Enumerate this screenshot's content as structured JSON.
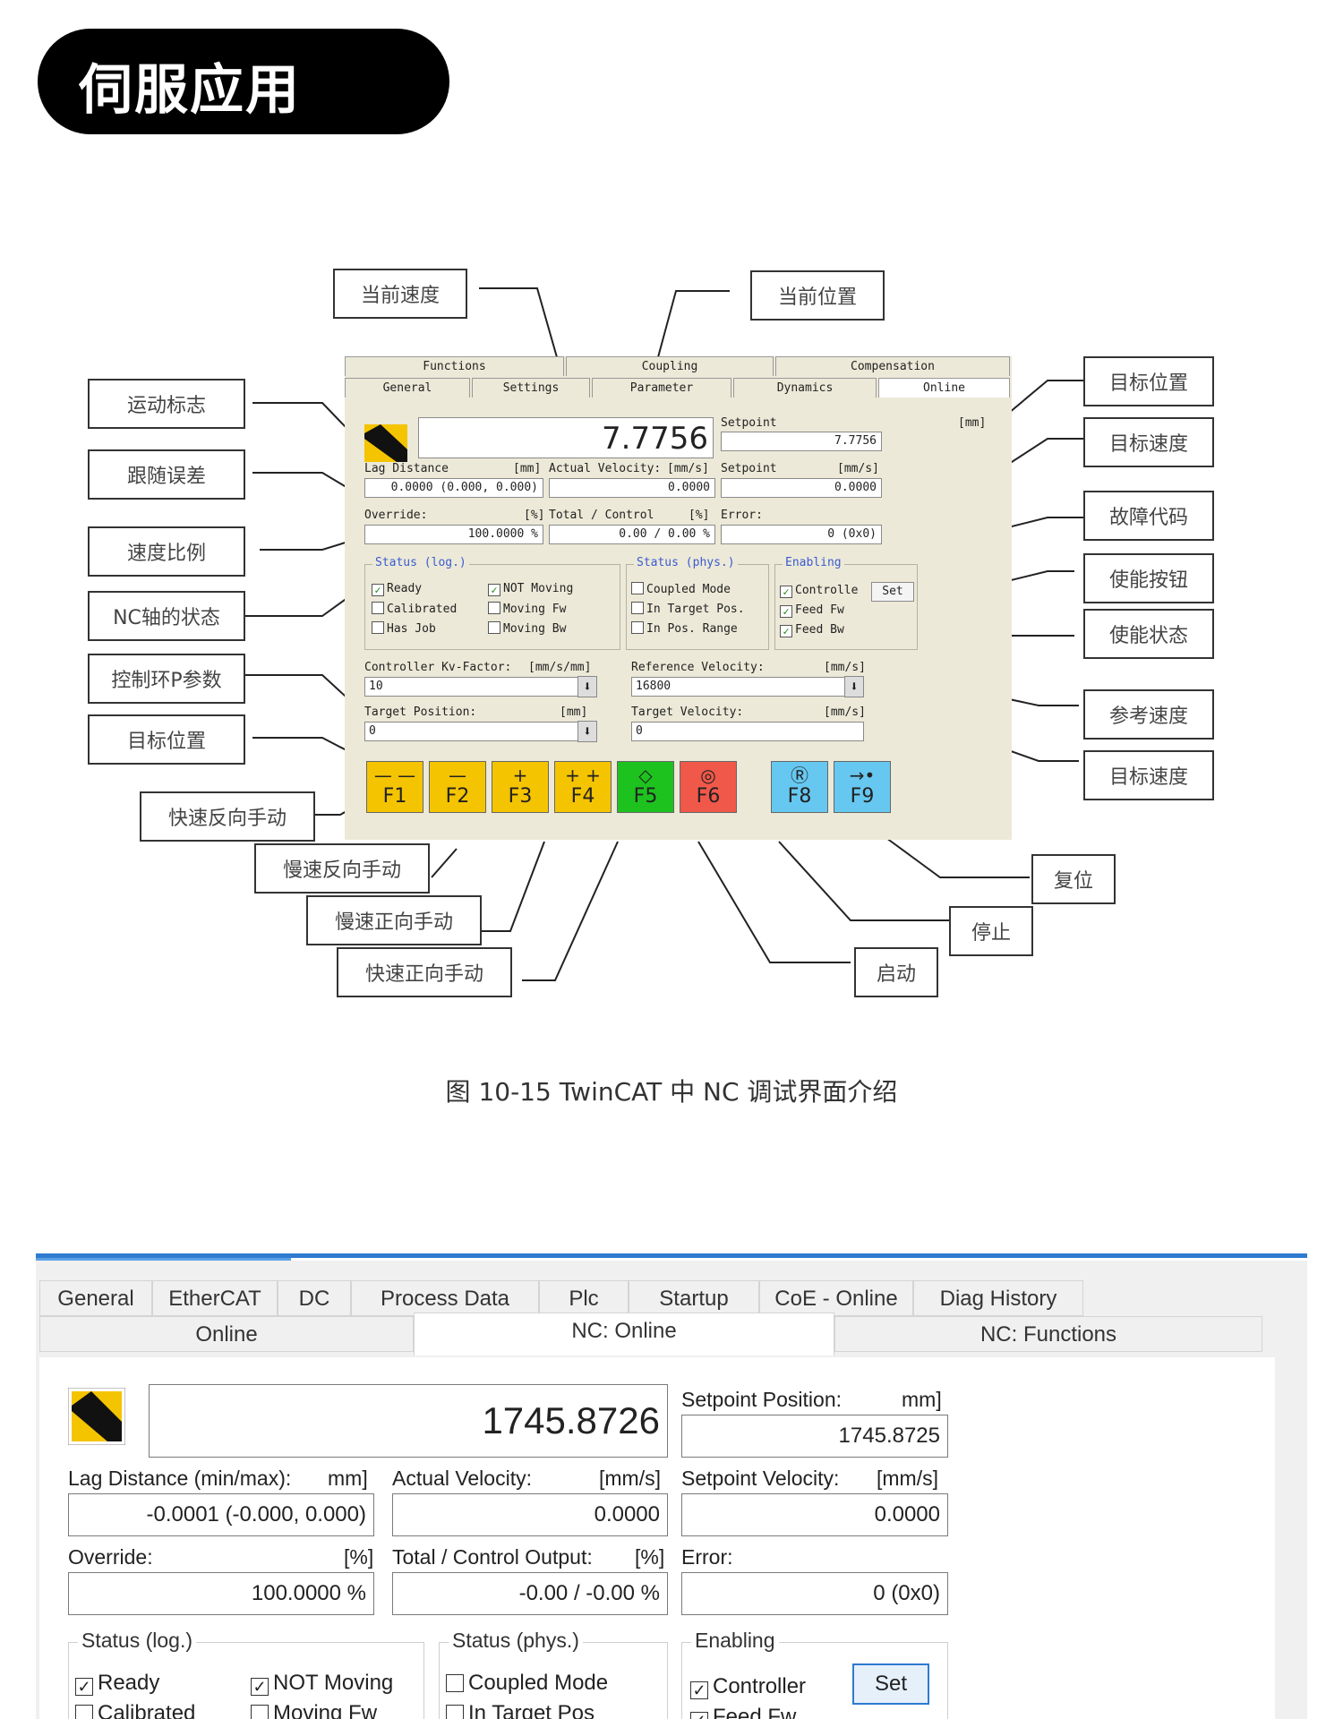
{
  "header": {
    "title": "伺服应用"
  },
  "figure": {
    "caption": "图 10-15 TwinCAT 中 NC 调试界面介绍",
    "annotations": {
      "current_velocity": "当前速度",
      "current_position": "当前位置",
      "motion_flag": "运动标志",
      "lag_error": "跟随误差",
      "speed_ratio": "速度比例",
      "nc_axis_state": "NC轴的状态",
      "control_loop_p": "控制环P参数",
      "target_position_left": "目标位置",
      "fast_reverse_jog": "快速反向手动",
      "slow_reverse_jog": "慢速反向手动",
      "slow_forward_jog": "慢速正向手动",
      "fast_forward_jog": "快速正向手动",
      "target_position_right": "目标位置",
      "target_velocity_right": "目标速度",
      "fault_code": "故障代码",
      "enable_button": "使能按钮",
      "enable_state": "使能状态",
      "reference_velocity": "参考速度",
      "target_velocity_bottom": "目标速度",
      "reset": "复位",
      "stop": "停止",
      "start": "启动"
    },
    "old_ui": {
      "tabs_row1": [
        "Functions",
        "Coupling",
        "Compensation"
      ],
      "tabs_row2": [
        "General",
        "Settings",
        "Parameter",
        "Dynamics",
        "Online"
      ],
      "position_value": "7.7756",
      "setpoint_label": "Setpoint",
      "setpoint_unit": "[mm]",
      "setpoint_value": "7.7756",
      "lag_label": "Lag Distance",
      "lag_unit": "[mm]",
      "lag_value": "0.0000  (0.000, 0.000)",
      "act_vel_label": "Actual Velocity:",
      "act_vel_unit": "[mm/s]",
      "act_vel_value": "0.0000",
      "sp_vel_label": "Setpoint",
      "sp_vel_unit": "[mm/s]",
      "sp_vel_value": "0.0000",
      "override_label": "Override:",
      "override_unit": "[%]",
      "override_value": "100.0000 %",
      "total_label": "Total / Control",
      "total_unit": "[%]",
      "total_value": "0.00 /  0.00 %",
      "error_label": "Error:",
      "error_value": "0  (0x0)",
      "status_log_title": "Status (log.)",
      "status_phys_title": "Status (phys.)",
      "enabling_title": "Enabling",
      "cb_ready": "Ready",
      "cb_calibrated": "Calibrated",
      "cb_has_job": "Has Job",
      "cb_not_moving": "NOT Moving",
      "cb_moving_fw": "Moving Fw",
      "cb_moving_bw": "Moving Bw",
      "cb_coupled": "Coupled Mode",
      "cb_in_target": "In Target Pos.",
      "cb_in_pos_range": "In Pos. Range",
      "cb_controller": "Controlle",
      "cb_feed_fw": "Feed Fw",
      "cb_feed_bw": "Feed Bw",
      "set_label": "Set",
      "kv_label": "Controller Kv-Factor:",
      "kv_unit": "[mm/s/mm]",
      "kv_value": "10",
      "ref_vel_label": "Reference Velocity:",
      "ref_vel_unit": "[mm/s]",
      "ref_vel_value": "16800",
      "target_pos_label": "Target Position:",
      "target_pos_unit": "[mm]",
      "target_pos_value": "0",
      "target_vel_label": "Target Velocity:",
      "target_vel_unit": "[mm/s]",
      "target_vel_value": "0",
      "buttons": [
        {
          "key": "F1",
          "sym": "— —",
          "color": "#f5c400"
        },
        {
          "key": "F2",
          "sym": "—",
          "color": "#f5c400"
        },
        {
          "key": "F3",
          "sym": "+",
          "color": "#f5c400"
        },
        {
          "key": "F4",
          "sym": "+ +",
          "color": "#f5c400"
        },
        {
          "key": "F5",
          "sym": "◇",
          "color": "#1ec21e"
        },
        {
          "key": "F6",
          "sym": "◎",
          "color": "#f0584a"
        },
        {
          "key": "F8",
          "sym": "Ⓡ",
          "color": "#66c8f0"
        },
        {
          "key": "F9",
          "sym": "→•",
          "color": "#66c8f0"
        }
      ]
    }
  },
  "modern": {
    "tabs_row1": [
      "General",
      "EtherCAT",
      "DC",
      "Process Data",
      "Plc",
      "Startup",
      "CoE - Online",
      "Diag History"
    ],
    "tabs_row2": [
      "Online",
      "NC: Online",
      "NC: Functions"
    ],
    "position_value": "1745.8726",
    "setpoint_pos_label": "Setpoint Position:",
    "setpoint_pos_unit": "mm]",
    "setpoint_pos_value": "1745.8725",
    "lag_label": "Lag Distance (min/max):",
    "lag_unit": "mm]",
    "lag_value": "-0.0001  (-0.000, 0.000)",
    "act_vel_label": "Actual Velocity:",
    "act_vel_unit": "[mm/s]",
    "act_vel_value": "0.0000",
    "sp_vel_label": "Setpoint Velocity:",
    "sp_vel_unit": "[mm/s]",
    "sp_vel_value": "0.0000",
    "override_label": "Override:",
    "override_unit": "[%]",
    "override_value": "100.0000 %",
    "total_label": "Total / Control Output:",
    "total_unit": "[%]",
    "total_value": "-0.00 / -0.00 %",
    "error_label": "Error:",
    "error_value": "0 (0x0)",
    "status_log_title": "Status (log.)",
    "status_phys_title": "Status (phys.)",
    "enabling_title": "Enabling",
    "cb_ready": "Ready",
    "cb_not_moving": "NOT Moving",
    "cb_coupled": "Coupled Mode",
    "cb_controller": "Controller",
    "set_label": "Set",
    "cb_calibrated": "Calibrated",
    "cb_moving_fw": "Moving Fw",
    "cb_in_target": "In Target Pos",
    "cb_feed_fw": "Feed Fw"
  }
}
